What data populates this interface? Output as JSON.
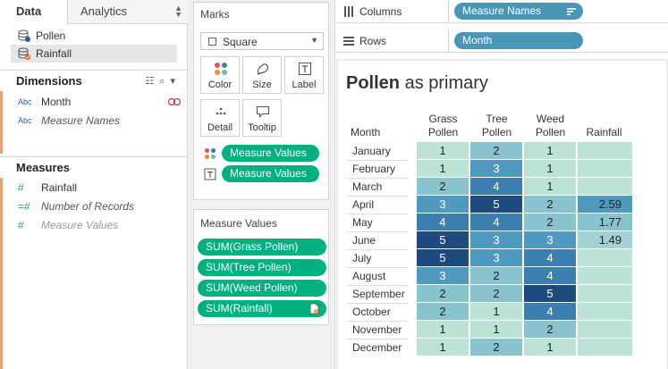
{
  "data_pane": {
    "tab_data": "Data",
    "tab_analytics": "Analytics",
    "data_sources": [
      "Pollen",
      "Rainfall"
    ],
    "dimensions_title": "Dimensions",
    "dimensions": [
      {
        "type": "Abc",
        "label": "Month"
      },
      {
        "type": "Abc",
        "label": "Measure Names"
      }
    ],
    "measures_title": "Measures",
    "measures": [
      {
        "type": "#",
        "label": "Rainfall"
      },
      {
        "type": "=#",
        "label": "Number of Records"
      },
      {
        "type": "#",
        "label": "Measure Values"
      }
    ]
  },
  "marks": {
    "title": "Marks",
    "mark_type": "Square",
    "buttons": [
      "Color",
      "Size",
      "Label",
      "Detail",
      "Tooltip"
    ],
    "pills": [
      "Measure Values",
      "Measure Values"
    ]
  },
  "measure_values": {
    "title": "Measure Values",
    "pills": [
      "SUM(Grass Pollen)",
      "SUM(Tree Pollen)",
      "SUM(Weed Pollen)",
      "SUM(Rainfall)"
    ]
  },
  "shelves": {
    "columns_label": "Columns",
    "columns_pill": "Measure Names",
    "rows_label": "Rows",
    "rows_pill": "Month"
  },
  "viz": {
    "title_bold": "Pollen",
    "title_rest": " as primary",
    "month_header": "Month",
    "column_headers": [
      [
        "Grass",
        "Pollen"
      ],
      [
        "Tree",
        "Pollen"
      ],
      [
        "Weed",
        "Pollen"
      ],
      [
        "Rainfall"
      ]
    ]
  },
  "colors": {
    "pill_green": "#00b180",
    "pill_blue": "#4a96b8",
    "ramp_low": "#bde3d9",
    "ramp_high": "#1f4a7d"
  },
  "chart_data": {
    "type": "heatmap",
    "rows": [
      "January",
      "February",
      "March",
      "April",
      "May",
      "June",
      "July",
      "August",
      "September",
      "October",
      "November",
      "December"
    ],
    "columns": [
      "Grass Pollen",
      "Tree Pollen",
      "Weed Pollen",
      "Rainfall"
    ],
    "values": [
      [
        1,
        2,
        1,
        null
      ],
      [
        1,
        3,
        1,
        null
      ],
      [
        2,
        4,
        1,
        null
      ],
      [
        3,
        5,
        2,
        "2.59"
      ],
      [
        4,
        4,
        2,
        "1.77"
      ],
      [
        5,
        3,
        3,
        "1.49"
      ],
      [
        5,
        3,
        4,
        null
      ],
      [
        3,
        2,
        4,
        null
      ],
      [
        2,
        2,
        5,
        null
      ],
      [
        2,
        1,
        4,
        null
      ],
      [
        1,
        1,
        2,
        null
      ],
      [
        1,
        2,
        1,
        null
      ]
    ]
  }
}
